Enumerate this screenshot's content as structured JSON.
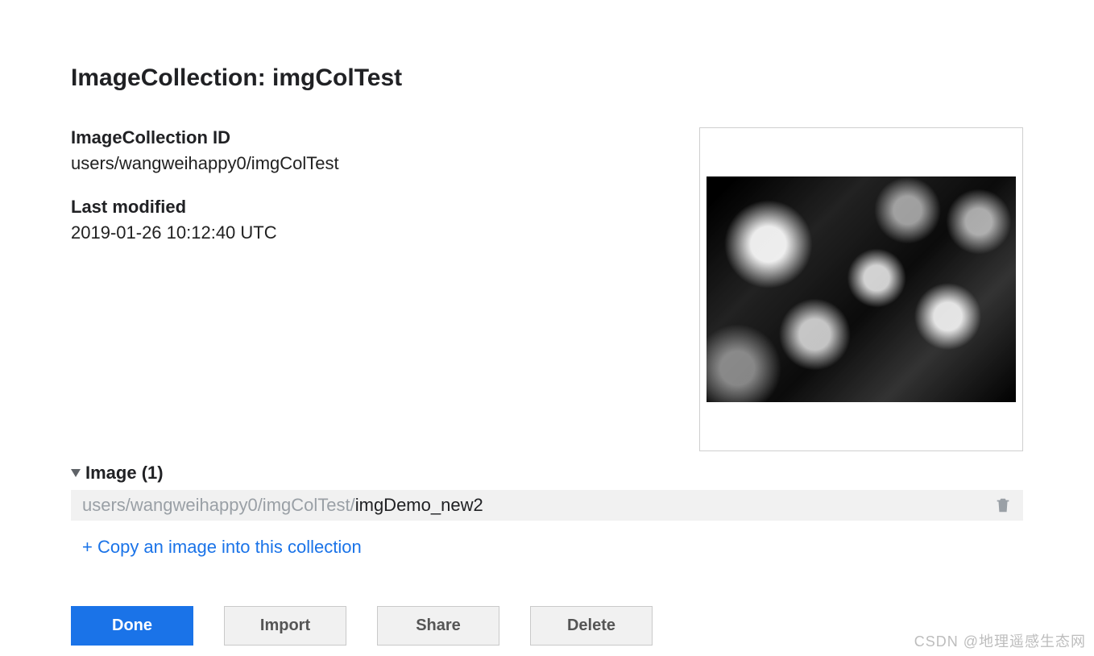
{
  "title": "ImageCollection: imgColTest",
  "meta": {
    "id_label": "ImageCollection ID",
    "id_value": "users/wangweihappy0/imgColTest",
    "modified_label": "Last modified",
    "modified_value": "2019-01-26 10:12:40 UTC"
  },
  "section": {
    "heading": "Image (1)",
    "row_prefix": "users/wangweihappy0/imgColTest/",
    "row_suffix": "imgDemo_new2"
  },
  "copy_link": "+ Copy an image into this collection",
  "buttons": {
    "done": "Done",
    "import": "Import",
    "share": "Share",
    "delete": "Delete"
  },
  "watermark": "CSDN @地理遥感生态网"
}
